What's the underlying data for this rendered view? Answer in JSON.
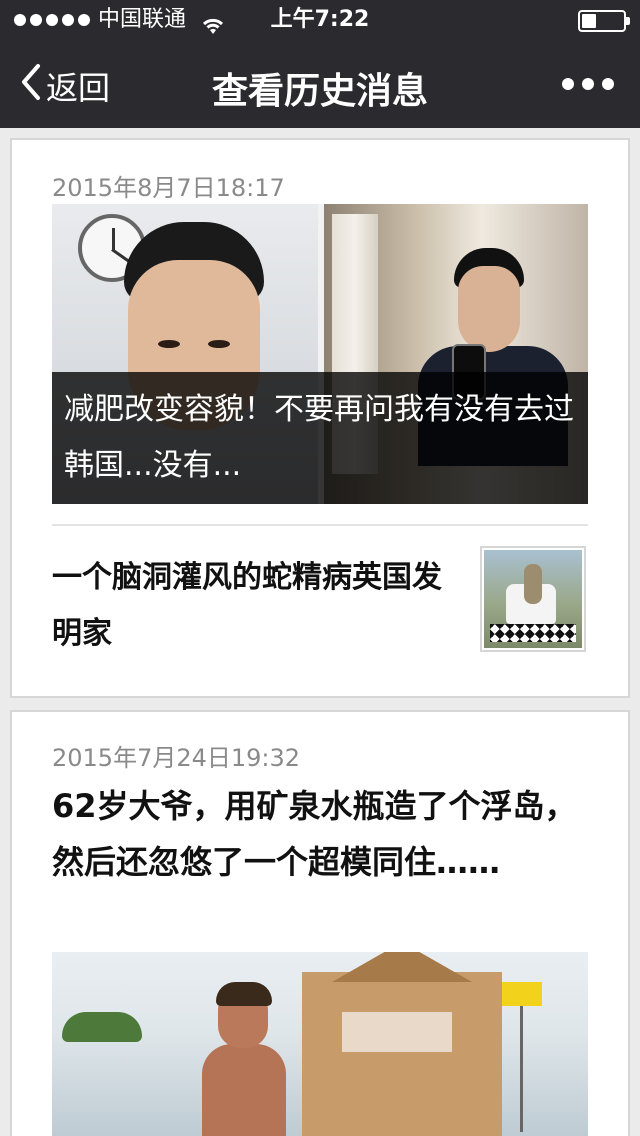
{
  "status_bar": {
    "carrier": "中国联通",
    "time": "上午7:22"
  },
  "nav": {
    "back_label": "返回",
    "title": "查看历史消息"
  },
  "icons": {
    "back": "chevron-left-icon",
    "more": "more-icon",
    "wifi": "wifi-icon",
    "signal": "signal-icon",
    "battery": "battery-icon"
  },
  "feed": {
    "cards": [
      {
        "date": "2015年8月7日18:17",
        "lead_caption": "减肥改变容貌！不要再问我有没有去过韩国...没有...",
        "items": [
          {
            "title": "一个脑洞灌风的蛇精病英国发明家"
          }
        ]
      },
      {
        "date": "2015年7月24日19:32",
        "headline": "62岁大爷，用矿泉水瓶造了个浮岛，然后还忽悠了一个超模同住……"
      }
    ]
  }
}
